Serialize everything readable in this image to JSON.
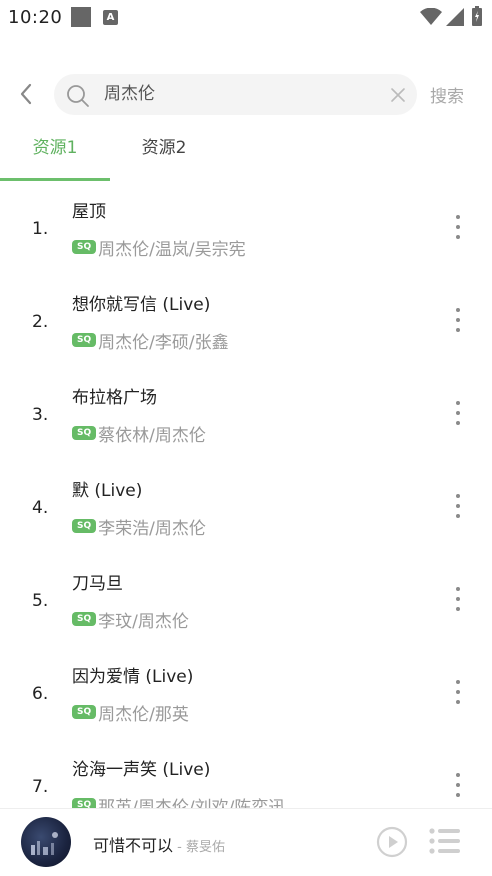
{
  "status_bar": {
    "time": "10:20",
    "icons": [
      "notification-square-icon",
      "a-box-icon",
      "wifi-icon",
      "cellular-signal-icon",
      "battery-icon"
    ]
  },
  "search": {
    "value": "周杰伦",
    "button_label": "搜索"
  },
  "tabs": [
    {
      "label": "资源1",
      "active": true
    },
    {
      "label": "资源2",
      "active": false
    }
  ],
  "songs": [
    {
      "index": "1.",
      "title": "屋顶",
      "badge": "SQ",
      "artists": "周杰伦/温岚/吴宗宪"
    },
    {
      "index": "2.",
      "title": "想你就写信 (Live)",
      "badge": "SQ",
      "artists": "周杰伦/李硕/张鑫"
    },
    {
      "index": "3.",
      "title": "布拉格广场",
      "badge": "SQ",
      "artists": "蔡依林/周杰伦"
    },
    {
      "index": "4.",
      "title": "默 (Live)",
      "badge": "SQ",
      "artists": "李荣浩/周杰伦"
    },
    {
      "index": "5.",
      "title": "刀马旦",
      "badge": "SQ",
      "artists": "李玟/周杰伦"
    },
    {
      "index": "6.",
      "title": "因为爱情 (Live)",
      "badge": "SQ",
      "artists": "周杰伦/那英"
    },
    {
      "index": "7.",
      "title": "沧海一声笑 (Live)",
      "badge": "SQ",
      "artists": "那英/周杰伦/刘欢/陈奕迅"
    }
  ],
  "player": {
    "title": "可惜不可以",
    "artist": " - 蔡旻佑"
  },
  "colors": {
    "accent": "#5fb15f",
    "badge": "#66bb66",
    "muted_text": "#9a9a9a"
  }
}
